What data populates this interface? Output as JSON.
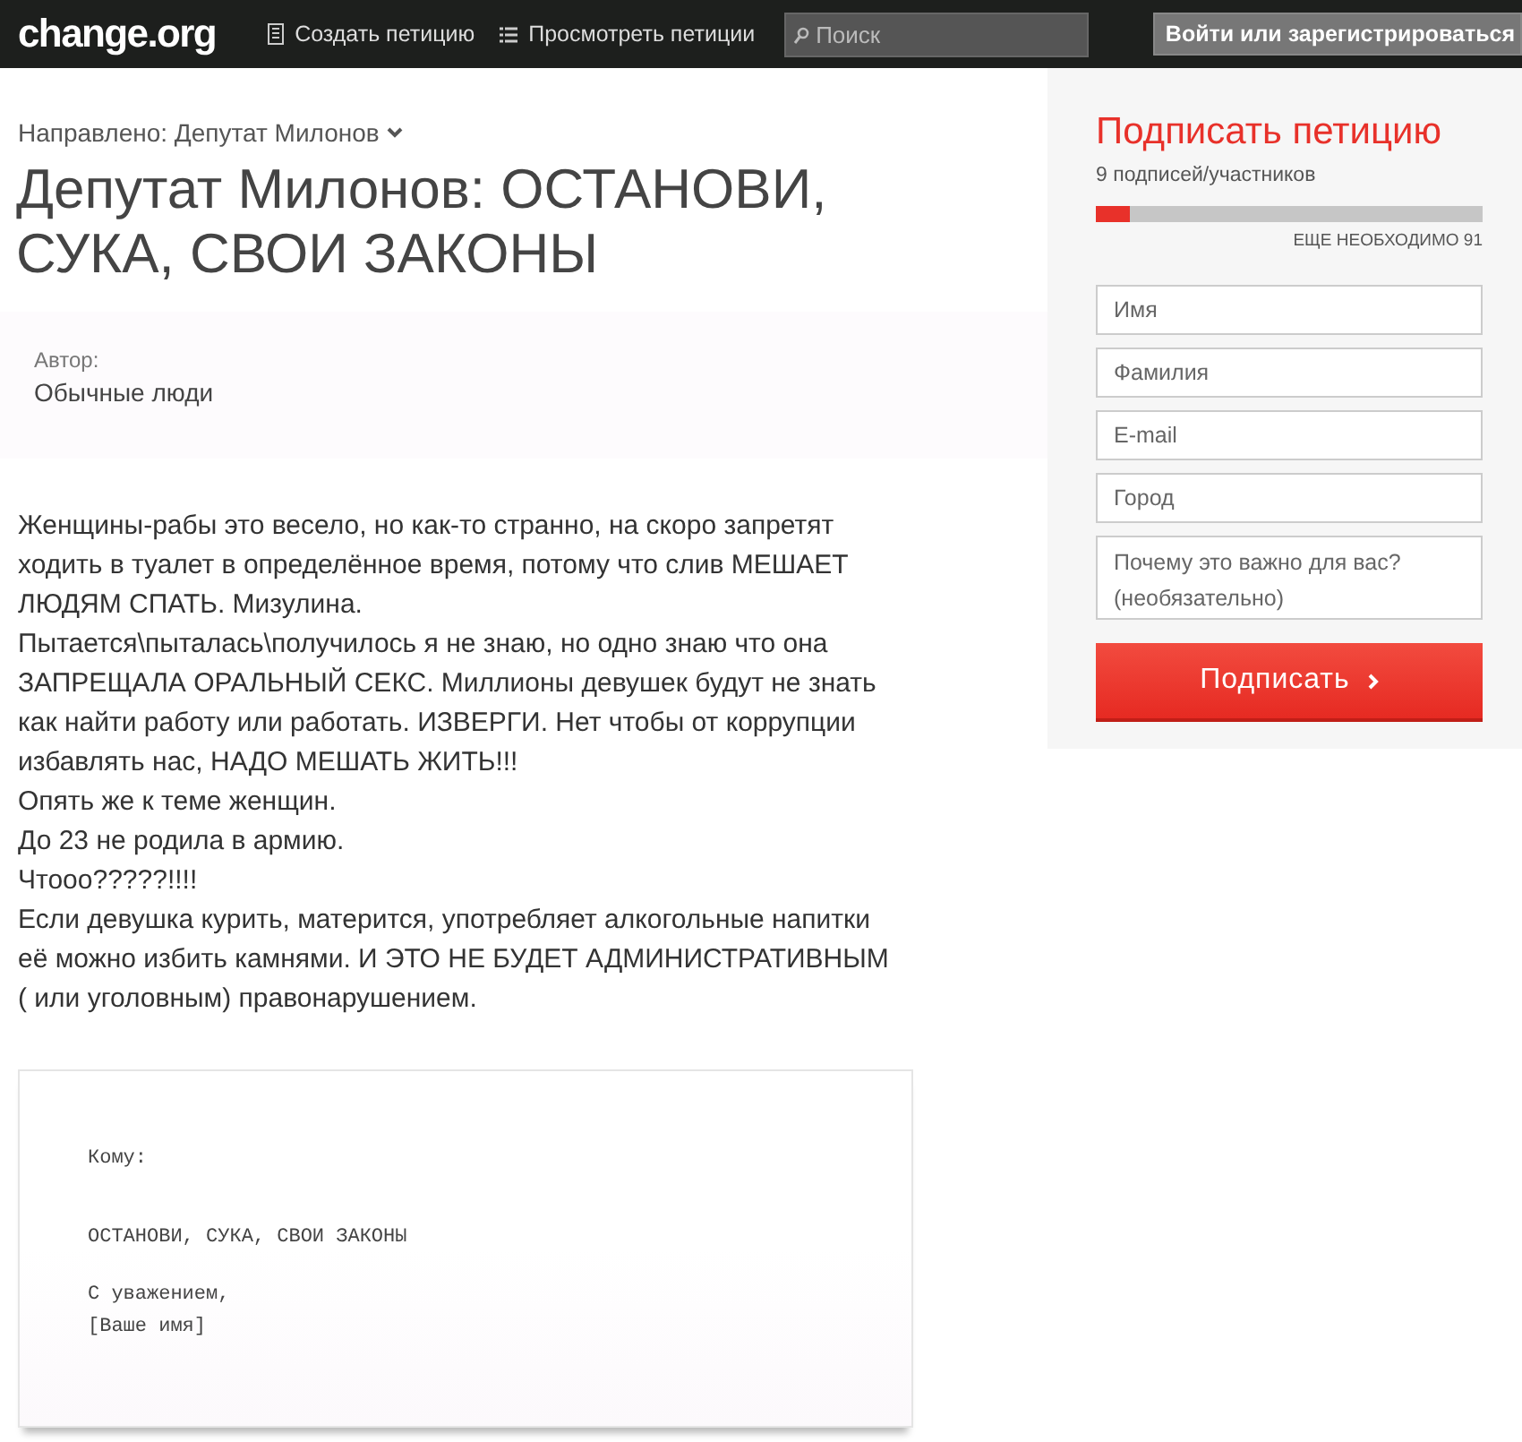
{
  "header": {
    "logo": "change.org",
    "nav": [
      {
        "kind": "create",
        "label": "Создать петицию"
      },
      {
        "kind": "browse",
        "label": "Просмотреть петиции"
      }
    ],
    "search": {
      "placeholder": "Поиск"
    },
    "login_button": "Войти или зарегистрироваться"
  },
  "petition": {
    "target": "Направлено: Депутат Милонов",
    "title": "Депутат Милонов: ОСТАНОВИ, СУКА, СВОИ ЗАКОНЫ",
    "author_label": "Автор:",
    "author": "Обычные люди",
    "body": [
      "Женщины-рабы это весело, но как-то странно, на скоро запретят ходить в туалет в определённое время, потому что слив МЕШАЕТ ЛЮДЯМ СПАТЬ. Мизулина.",
      "Пытается\\пыталась\\получилось я не знаю, но одно знаю что она ЗАПРЕЩАЛА ОРАЛЬНЫЙ СЕКС. Миллионы девушек будут не знать как найти работу или работать. ИЗВЕРГИ. Нет чтобы от коррупции избавлять нас, НАДО МЕШАТЬ ЖИТЬ!!!",
      "Опять же к теме женщин.",
      "До 23 не родила в армию.",
      "Чтооо?????!!!!",
      "Если девушка курить, матерится, употребляет алкогольные напитки её можно избить камнями. И ЭТО НЕ БУДЕТ АДМИНИСТРАТИВНЫМ ( или уголовным) правонарушением."
    ],
    "letter": {
      "to": "Кому:",
      "subject": "ОСТАНОВИ, СУКА, СВОИ ЗАКОНЫ",
      "closing": "С уважением,",
      "signature": "[Ваше имя]"
    }
  },
  "sign": {
    "title": "Подписать петицию",
    "count": "9 подписей/участников",
    "progress": {
      "level": 0.09
    },
    "needed": "ЕЩЕ НЕОБХОДИМО 91",
    "fields": [
      {
        "placeholder": "Имя"
      },
      {
        "placeholder": "Фамилия"
      },
      {
        "placeholder": "E-mail"
      },
      {
        "placeholder": "Город"
      },
      {
        "kind": "textarea",
        "placeholder": "Почему это важно для вас? (необязательно)"
      }
    ],
    "button": "Подписать"
  }
}
